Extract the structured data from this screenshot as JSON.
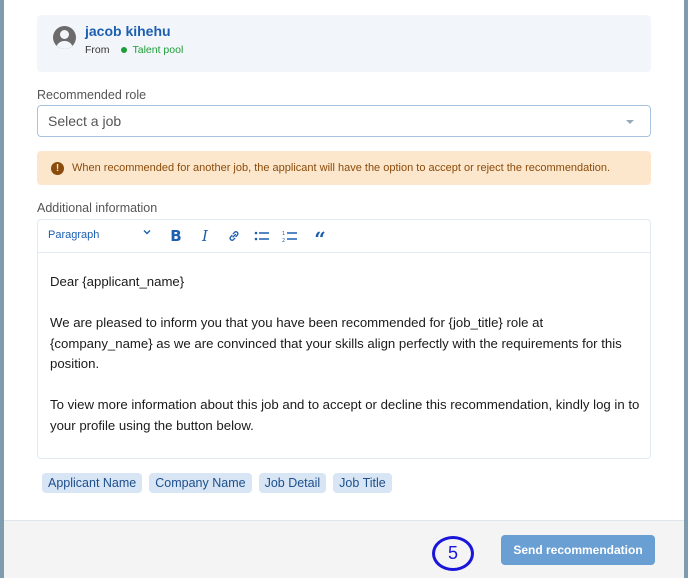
{
  "candidate": {
    "name": "jacob kihehu",
    "from_label": "From",
    "source": "Talent pool",
    "source_color": "#1f9d37"
  },
  "recommended_role": {
    "label": "Recommended role",
    "placeholder": "Select a job"
  },
  "warning": {
    "icon": "exclamation-icon",
    "text": "When recommended for another job, the applicant will have the option to accept or reject the recommendation."
  },
  "additional_info": {
    "label": "Additional information",
    "toolbar": {
      "block_format": "Paragraph",
      "chevron": "⌄",
      "bold": "B",
      "italic": "I",
      "link": "🔗",
      "bulleted_list": "☰",
      "numbered_list": "☰",
      "quote": "“"
    },
    "body": [
      "Dear {applicant_name}",
      "We are pleased to inform you that you have been recommended for {job_title} role at {company_name} as we are convinced that your skills align perfectly with the requirements for this position.",
      "To view more information about this job and to accept or decline this recommendation, kindly log in to your profile using the button below."
    ]
  },
  "tags": [
    "Applicant Name",
    "Company Name",
    "Job Detail",
    "Job Title"
  ],
  "footer": {
    "step_number": "5",
    "send_button": "Send recommendation"
  },
  "colors": {
    "accent": "#1c5fb0",
    "button": "#6a9fd4",
    "warning_bg": "#fde7cc",
    "warning_text": "#8a4b0b",
    "step_ring": "#1a16d9"
  }
}
